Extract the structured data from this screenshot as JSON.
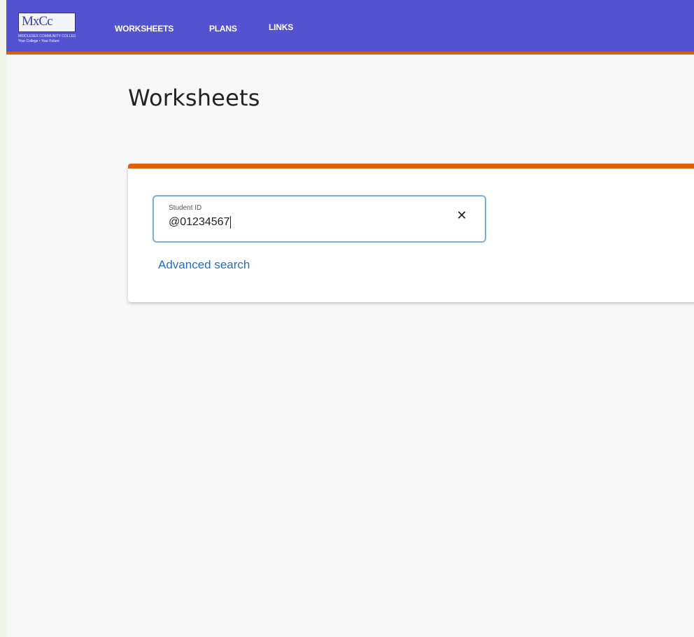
{
  "colors": {
    "header_bg": "#5353d2",
    "accent_orange": "#e0600a",
    "link_blue": "#1f6fc4",
    "page_bg": "#f8f8f8"
  },
  "header": {
    "logo": {
      "mark": "MxCc",
      "subtitle": "MIDDLESEX COMMUNITY COLLEGE",
      "tagline": "Your College • Your Future"
    },
    "nav": [
      {
        "label": "WORKSHEETS"
      },
      {
        "label": "PLANS"
      },
      {
        "label": "LINKS"
      }
    ]
  },
  "main": {
    "title": "Worksheets",
    "search": {
      "label": "Student ID",
      "value": "@01234567",
      "clear_icon": "close-icon",
      "clear_glyph": "✕",
      "advanced_link": "Advanced search"
    }
  }
}
